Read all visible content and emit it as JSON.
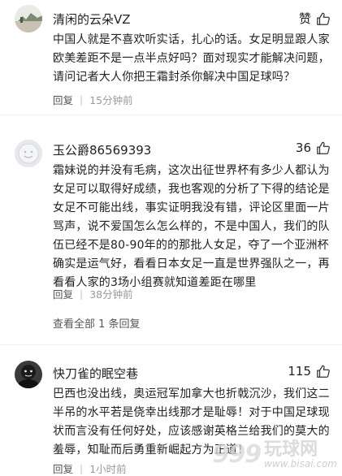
{
  "comments": [
    {
      "username": "清闲的云朵VZ",
      "likes": "赞",
      "text": "中国人就是不喜欢听实话，扎心的话。女足明显跟人家欧美差距不是一点半点好吗？面对现实才能解决问题，请问记者大人你把王霜封杀你解决中国足球吗？",
      "reply": "回复",
      "time": "15分钟前"
    },
    {
      "username": "玉公爵86569393",
      "likes": "36",
      "text": "霜妹说的并没有毛病，这次出征世界杯有多少人都认为女足可以取得好成绩，我也客观的分析了下得的结论是女足不可能出线，事实证明我没有错，评论区里面一片骂声，说不爱国怎么怎么样的，不是中国人，我们的队伍已经不是80-90年的的那批人女足，夺了一个亚洲杯确实是运气好，看看日本女足一直是世界强队之一，再看看人家的3场小组赛就知道差距在哪里",
      "reply": "回复",
      "time": "38分钟前",
      "view_replies": "查看全部 1 条回复"
    },
    {
      "username": "快刀雀的眠空巷",
      "likes": "115",
      "text": "巴西也没出线，奥运冠军加拿大也折戟沉沙，我们这二半吊的水平若是侥幸出线那才是耻辱！对于中国足球现状而言没有任何好处，应该感谢英格兰给我们的莫大的羞辱，知耻而后勇重新崛起方为正道！",
      "reply": "回复",
      "time": "1小时前"
    }
  ],
  "watermark": {
    "number": "999",
    "site_cn": "玩球网",
    "site_en": "www.bisai.com"
  },
  "colors": {
    "text": "#222222",
    "meta": "#555555",
    "time": "#9a9a9a",
    "divider": "#eeeeee"
  }
}
